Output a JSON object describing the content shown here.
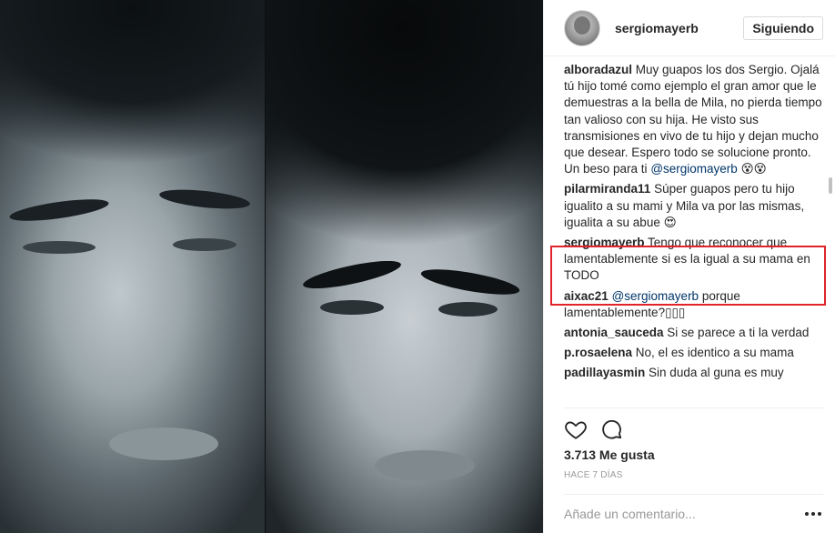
{
  "post": {
    "username": "sergiomayerb",
    "follow_label": "Siguiendo"
  },
  "comments": [
    {
      "user": "alboradazul",
      "text_before": " Muy guapos los dos Sergio. Ojalá tú hijo tomé como ejemplo el gran amor que le demuestras a la bella de Mila, no pierda tiempo tan valioso con su hija. He visto sus transmisiones en vivo de tu hijo y dejan mucho que desear. Espero todo se solucione pronto. Un beso para ti ",
      "mention": "@sergiomayerb",
      "text_after": " 😵😵"
    },
    {
      "user": "pilarmiranda11",
      "text_before": " Súper guapos pero tu hijo igualito a su mami y Mila va por las mismas, igualita a su abue 😍",
      "mention": "",
      "text_after": ""
    },
    {
      "user": "sergiomayerb",
      "text_before": " Tengo que reconocer que lamentablemente si es la igual a su mama en TODO",
      "mention": "",
      "text_after": ""
    },
    {
      "user": "aixac21",
      "text_before": " ",
      "mention": "@sergiomayerb",
      "text_after": " porque lamentablemente?▯▯▯"
    },
    {
      "user": "antonia_sauceda",
      "text_before": " Si se parece a ti la verdad",
      "mention": "",
      "text_after": ""
    },
    {
      "user": "p.rosaelena",
      "text_before": " No, el es identico a su mama",
      "mention": "",
      "text_after": ""
    },
    {
      "user": "padillayasmin",
      "text_before": " Sin duda al guna es muy",
      "mention": "",
      "text_after": ""
    }
  ],
  "actions": {
    "like_icon": "heart-icon",
    "comment_icon": "comment-icon"
  },
  "likes_text": "3.713 Me gusta",
  "time_text": "HACE 7 DÍAS",
  "add_comment": {
    "placeholder": "Añade un comentario..."
  },
  "colors": {
    "highlight": "#e0242b",
    "mention": "#003569",
    "text": "#262626",
    "muted": "#999999"
  }
}
